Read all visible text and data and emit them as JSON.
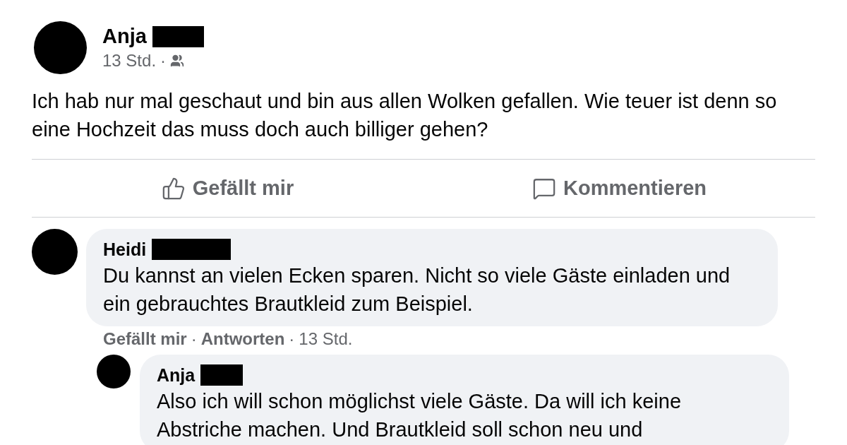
{
  "post": {
    "author": "Anja",
    "time": "13 Std.",
    "separator": "·",
    "text": "Ich hab nur mal geschaut und bin aus allen Wolken gefallen. Wie teuer ist denn so eine Hochzeit das muss doch auch billiger gehen?"
  },
  "actions": [
    {
      "kind": "like",
      "label": "Gefällt mir"
    },
    {
      "kind": "comment",
      "label": "Kommentieren"
    }
  ],
  "comments": [
    {
      "author": "Heidi",
      "text": "Du kannst an vielen Ecken sparen. Nicht so viele Gäste einladen und ein gebrauchtes Brautkleid zum Beispiel.",
      "like": "Gefällt mir",
      "separator": "·",
      "reply": "Antworten",
      "time": "13 Std.",
      "replies": [
        {
          "author": "Anja",
          "text": "Also ich will schon möglichst viele Gäste. Da will ich keine Abstriche machen. Und Brautkleid soll schon neu und"
        }
      ]
    }
  ]
}
